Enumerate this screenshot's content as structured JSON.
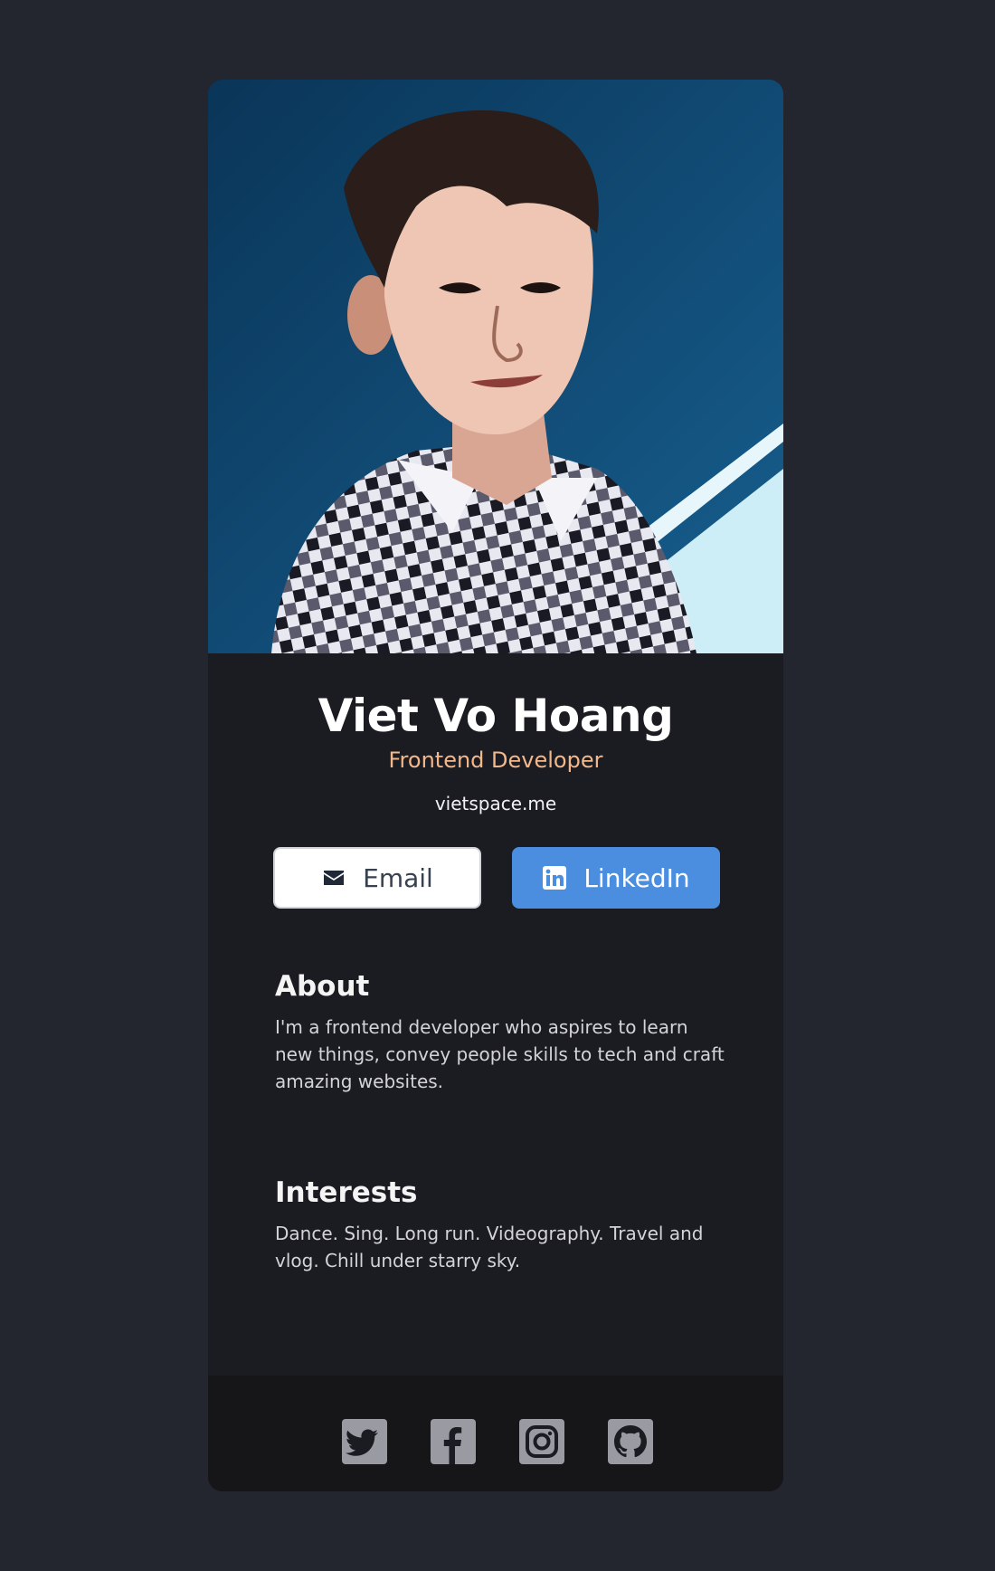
{
  "profile": {
    "name": "Viet Vo Hoang",
    "role": "Frontend Developer",
    "website": "vietspace.me"
  },
  "buttons": {
    "email": {
      "label": "Email",
      "icon": "envelope-icon"
    },
    "linkedin": {
      "label": "LinkedIn",
      "icon": "linkedin-icon"
    }
  },
  "about": {
    "title": "About",
    "body": "I'm a frontend developer who aspires to learn new things, convey people skills to tech and craft amazing websites."
  },
  "interests": {
    "title": "Interests",
    "body": "Dance. Sing. Long run. Videography. Travel and vlog. Chill under starry sky."
  },
  "footer": {
    "social_icons": [
      "twitter-icon",
      "facebook-icon",
      "instagram-icon",
      "github-icon"
    ]
  },
  "colors": {
    "page_background": "#23252f",
    "card_background": "#1b1c21",
    "footer_background": "#161619",
    "role_accent": "#f3b78c",
    "linkedin_blue": "#4b8ee0",
    "social_icon": "#9a9aa2"
  }
}
